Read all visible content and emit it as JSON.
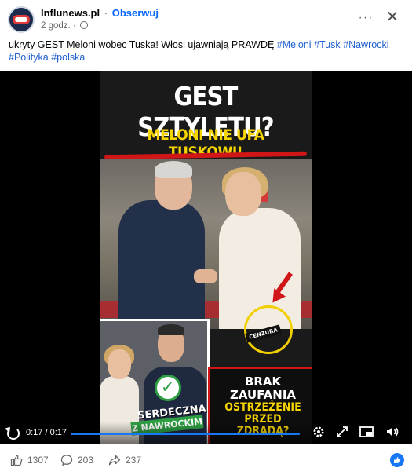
{
  "header": {
    "page_name": "Influnews.pl",
    "separator": "·",
    "follow_label": "Obserwuj",
    "time_ago": "2 godz. ·",
    "more_label": "···",
    "close_label": "✕"
  },
  "caption": {
    "text": "ukryty GEST Meloni wobec Tuska! Włosi ujawniają PRAWDĘ",
    "hashtags": [
      "#Meloni",
      "#Tusk",
      "#Nawrocki",
      "#Polityka",
      "#polska"
    ]
  },
  "thumbnail": {
    "headline": "GEST SZTYLETU?",
    "subheadline": "MELONI NIE UFA TUSKOWI!",
    "stamp": "CENZURA",
    "inset_line1": "SERDECZNA",
    "inset_line2": "Z NAWROCKIM",
    "box_line1": "BRAK ZAUFANIA",
    "box_line2": "OSTRZEŻENIE PRZED ZDRADĄ?"
  },
  "video": {
    "time_display": "0:17 / 0:17",
    "progress": 1.0,
    "icons": [
      "replay-icon",
      "settings-icon",
      "fullscreen-icon",
      "miniplayer-icon",
      "volume-icon"
    ]
  },
  "footer": {
    "likes": "1307",
    "comments": "203",
    "shares": "237"
  },
  "colors": {
    "accent": "#0866ff",
    "hashtag": "#1f5fcf",
    "progress": "#1877f2",
    "headline_yellow": "#f5d400",
    "stripe_red": "#d01616"
  }
}
